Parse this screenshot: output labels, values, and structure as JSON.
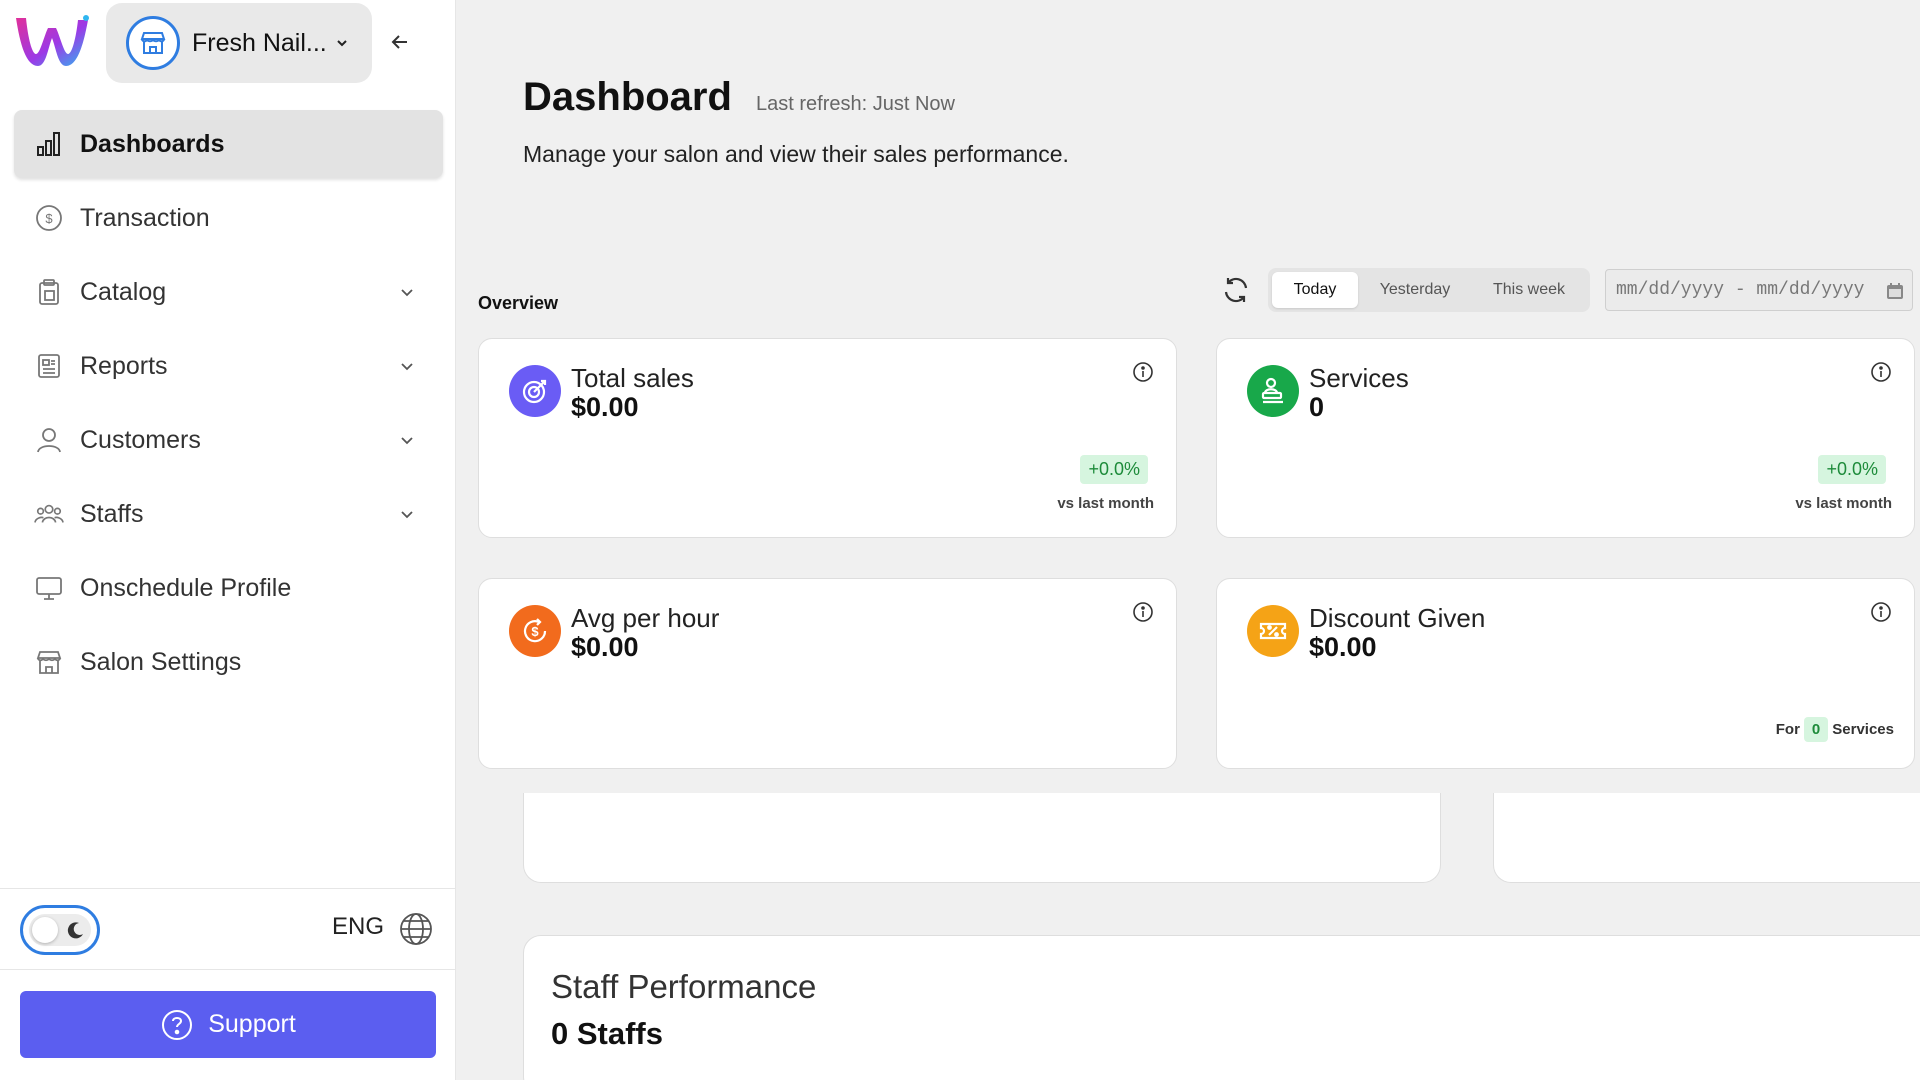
{
  "app": {
    "store_name": "Fresh Nail...",
    "colors": {
      "accent": "#5b5ef0",
      "blue": "#2f7de1",
      "purple": "#6a5cf5",
      "green": "#18a84a",
      "orange": "#f26b1d",
      "amber": "#f5a316"
    }
  },
  "sidebar": {
    "items": [
      {
        "label": "Dashboards",
        "icon": "bar-chart-icon",
        "active": true
      },
      {
        "label": "Transaction",
        "icon": "dollar-circle-icon"
      },
      {
        "label": "Catalog",
        "icon": "clipboard-icon",
        "expandable": true
      },
      {
        "label": "Reports",
        "icon": "document-icon",
        "expandable": true
      },
      {
        "label": "Customers",
        "icon": "user-icon",
        "expandable": true
      },
      {
        "label": "Staffs",
        "icon": "users-group-icon",
        "expandable": true
      },
      {
        "label": "Onschedule Profile",
        "icon": "monitor-icon"
      },
      {
        "label": "Salon Settings",
        "icon": "store-icon"
      }
    ],
    "language": "ENG",
    "support_label": "Support"
  },
  "header": {
    "title": "Dashboard",
    "last_refresh": "Last refresh: Just Now",
    "subtitle": "Manage your salon and view their sales performance."
  },
  "overview": {
    "label": "Overview",
    "ranges": [
      "Today",
      "Yesterday",
      "This week"
    ],
    "active_range": "Today",
    "date_placeholder": "mm/dd/yyyy - mm/dd/yyyy"
  },
  "cards": {
    "total_sales": {
      "title": "Total sales",
      "value": "$0.00",
      "delta": "+0.0%",
      "vs": "vs last month"
    },
    "services": {
      "title": "Services",
      "value": "0",
      "delta": "+0.0%",
      "vs": "vs last month"
    },
    "avg_per_hour": {
      "title": "Avg per hour",
      "value": "$0.00"
    },
    "discount": {
      "title": "Discount Given",
      "value": "$0.00",
      "for_prefix": "For",
      "for_count": "0",
      "for_suffix": "Services"
    }
  },
  "staff_performance": {
    "title": "Staff Performance",
    "count": "0 Staffs"
  }
}
